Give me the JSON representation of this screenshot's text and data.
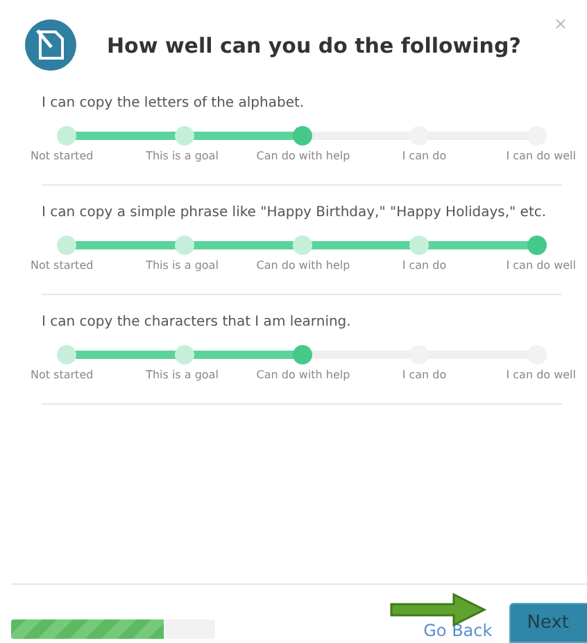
{
  "dialog": {
    "title": "How well can you do the following?",
    "close": "×"
  },
  "questions": [
    {
      "text": "I can copy the letters of the alphabet.",
      "stops": [
        {
          "label": "Not started",
          "selected": false
        },
        {
          "label": "This is a goal",
          "selected": false
        },
        {
          "label": "Can do with help",
          "selected": true
        },
        {
          "label": "I can do",
          "selected": false
        },
        {
          "label": "I can do well",
          "selected": false
        }
      ]
    },
    {
      "text": "I can copy a simple phrase like \"Happy Birthday,\" \"Happy Holidays,\" etc.",
      "stops": [
        {
          "label": "Not started",
          "selected": false
        },
        {
          "label": "This is a goal",
          "selected": false
        },
        {
          "label": "Can do with help",
          "selected": false
        },
        {
          "label": "I can do",
          "selected": false
        },
        {
          "label": "I can do well",
          "selected": true
        }
      ]
    },
    {
      "text": "I can copy the characters that I am learning.",
      "stops": [
        {
          "label": "Not started",
          "selected": false
        },
        {
          "label": "This is a goal",
          "selected": false
        },
        {
          "label": "Can do with help",
          "selected": true
        },
        {
          "label": "I can do",
          "selected": false
        },
        {
          "label": "I can do well",
          "selected": false
        }
      ]
    }
  ],
  "footer": {
    "progress": {
      "level": 0.75
    },
    "back": "Go Back",
    "next": "Next"
  }
}
